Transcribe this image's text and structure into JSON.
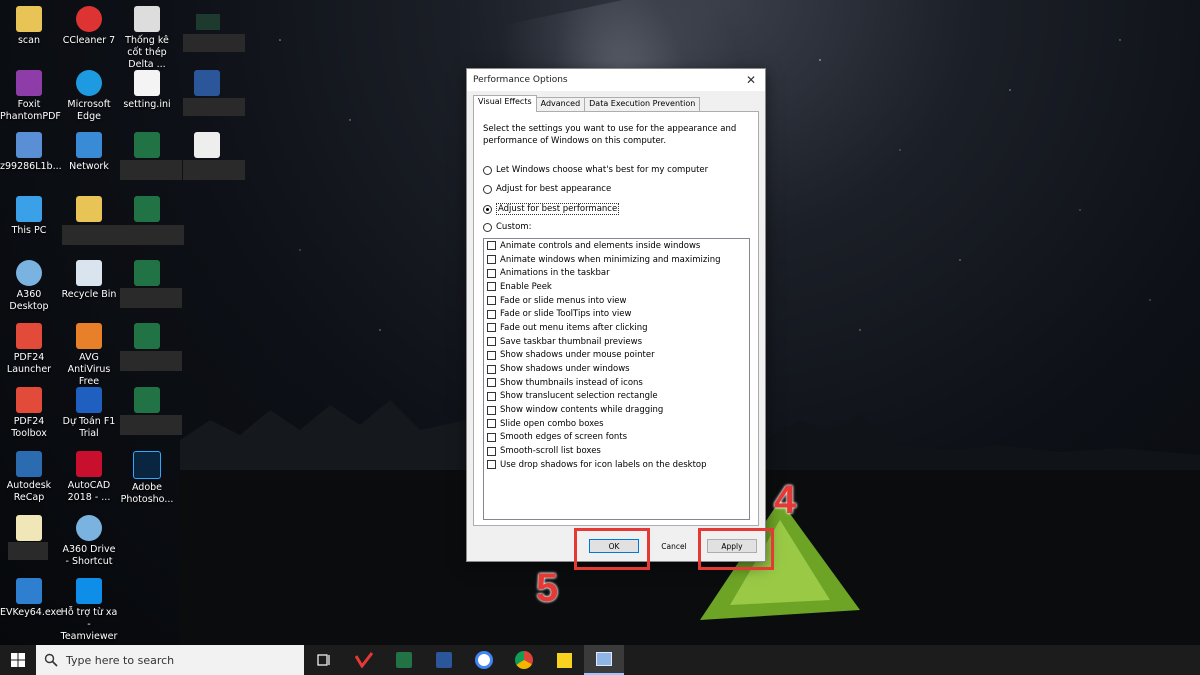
{
  "desktop": {
    "icons": [
      {
        "label": "scan"
      },
      {
        "label": "CCleaner 7"
      },
      {
        "label": "Thống kê cốt thép Delta ..."
      },
      {
        "label": "Foxit PhantomPDF"
      },
      {
        "label": "Microsoft Edge"
      },
      {
        "label": "setting.ini"
      },
      {
        "label": "z99286L1b..."
      },
      {
        "label": "Network"
      },
      {
        "label": "This PC"
      },
      {
        "label": "A360 Desktop"
      },
      {
        "label": "Recycle Bin"
      },
      {
        "label": "PDF24 Launcher"
      },
      {
        "label": "AVG AntiVirus Free"
      },
      {
        "label": "PDF24 Toolbox"
      },
      {
        "label": "Dự Toán F1 Trial"
      },
      {
        "label": "Autodesk ReCap"
      },
      {
        "label": "AutoCAD 2018 - ..."
      },
      {
        "label": "Adobe Photosho..."
      },
      {
        "label": "A360 Drive - Shortcut"
      },
      {
        "label": "EVKey64.exe"
      },
      {
        "label": "Hỗ trợ từ xa - Teamviewer"
      }
    ]
  },
  "dialog": {
    "title": "Performance Options",
    "tabs": [
      "Visual Effects",
      "Advanced",
      "Data Execution Prevention"
    ],
    "intro": "Select the settings you want to use for the appearance and performance of Windows on this computer.",
    "options": [
      {
        "label": "Let Windows choose what's best for my computer",
        "checked": false
      },
      {
        "label": "Adjust for best appearance",
        "checked": false
      },
      {
        "label": "Adjust for best performance",
        "checked": true
      },
      {
        "label": "Custom:",
        "checked": false
      }
    ],
    "effects": [
      "Animate controls and elements inside windows",
      "Animate windows when minimizing and maximizing",
      "Animations in the taskbar",
      "Enable Peek",
      "Fade or slide menus into view",
      "Fade or slide ToolTips into view",
      "Fade out menu items after clicking",
      "Save taskbar thumbnail previews",
      "Show shadows under mouse pointer",
      "Show shadows under windows",
      "Show thumbnails instead of icons",
      "Show translucent selection rectangle",
      "Show window contents while dragging",
      "Slide open combo boxes",
      "Smooth edges of screen fonts",
      "Smooth-scroll list boxes",
      "Use drop shadows for icon labels on the desktop"
    ],
    "buttons": {
      "ok": "OK",
      "cancel": "Cancel",
      "apply": "Apply"
    }
  },
  "annotations": {
    "step_apply": "4",
    "step_ok": "5",
    "color": "#e53935"
  },
  "taskbar": {
    "search_placeholder": "Type here to search",
    "icons": [
      "start-icon",
      "task-view-icon",
      "app-red-icon",
      "excel-icon",
      "word-icon",
      "chrome-profile-icon",
      "chrome-icon",
      "sticky-notes-icon",
      "performance-options-icon"
    ]
  }
}
